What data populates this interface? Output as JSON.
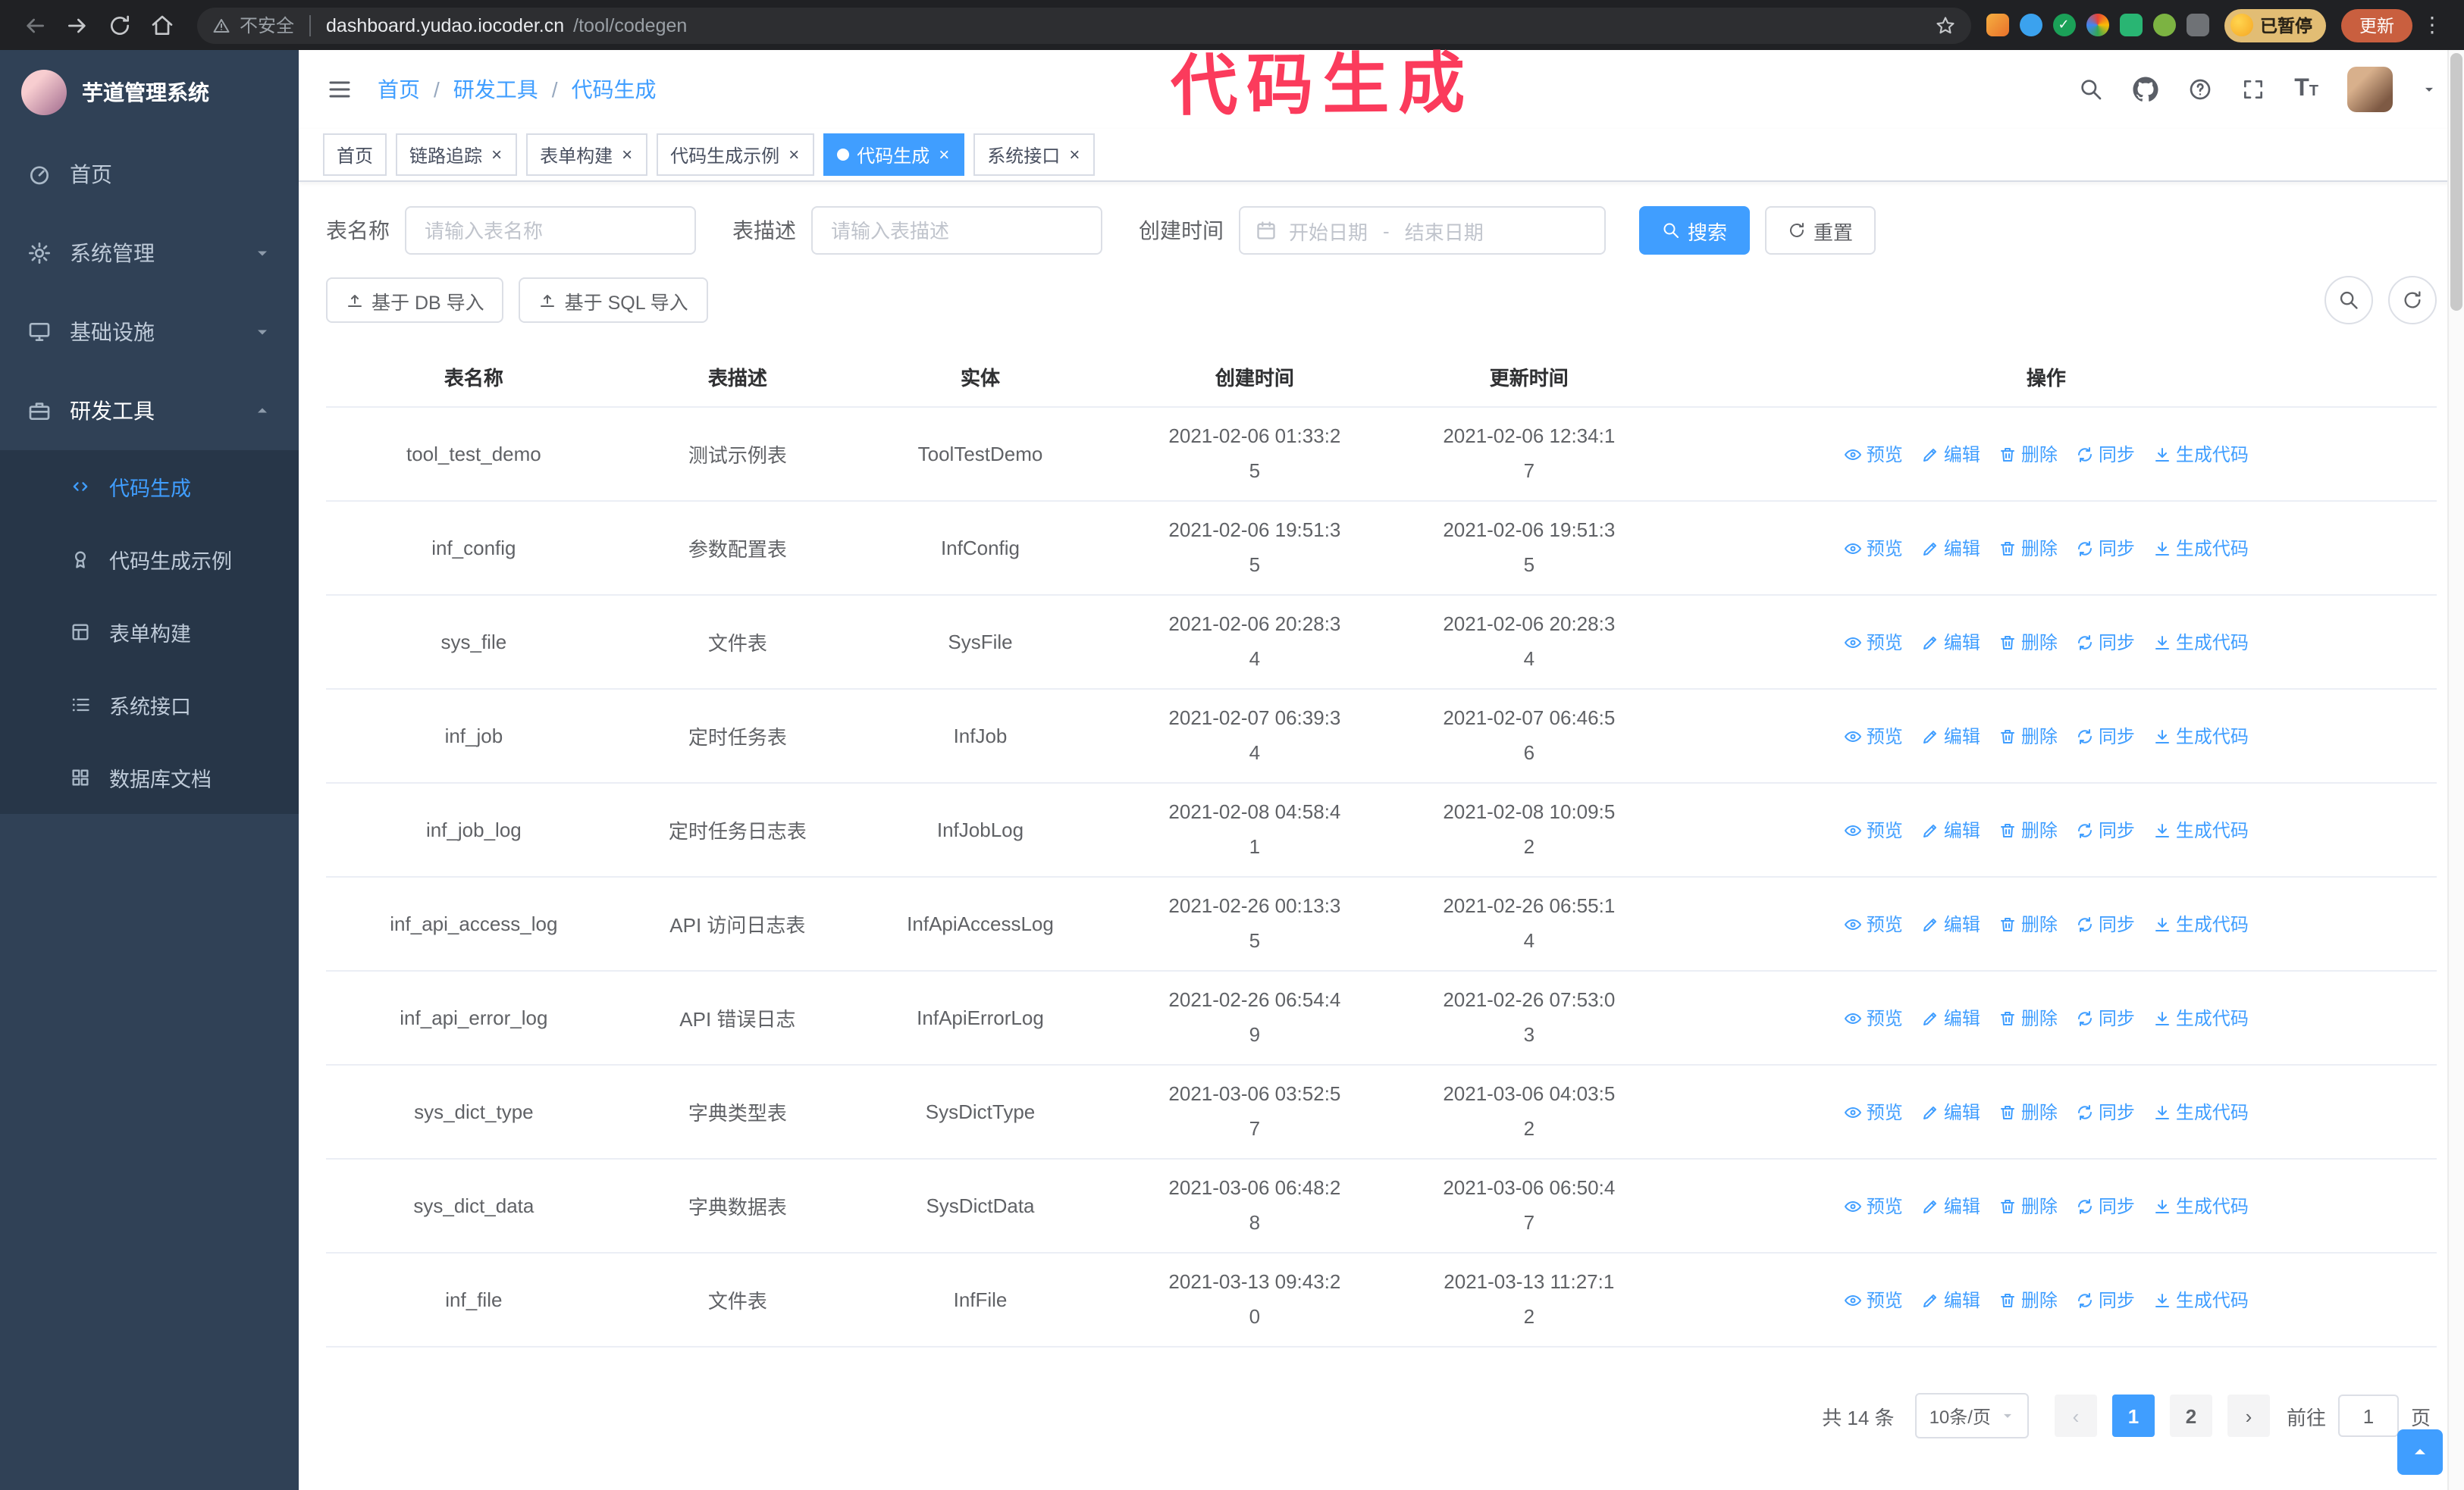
{
  "browser": {
    "security_label": "不安全",
    "url_host": "dashboard.yudao.iocoder.cn",
    "url_path": "/tool/codegen",
    "profile_badge": "已暂停",
    "update_button": "更新"
  },
  "annotation": {
    "text": "代码生成"
  },
  "sidebar": {
    "logo_title": "芋道管理系统",
    "items": [
      {
        "label": "首页",
        "icon": "dashboard"
      },
      {
        "label": "系统管理",
        "icon": "gear"
      },
      {
        "label": "基础设施",
        "icon": "monitor"
      },
      {
        "label": "研发工具",
        "icon": "toolbox"
      }
    ],
    "submenu": [
      {
        "label": "代码生成",
        "icon": "code",
        "active": true
      },
      {
        "label": "代码生成示例",
        "icon": "badge"
      },
      {
        "label": "表单构建",
        "icon": "form"
      },
      {
        "label": "系统接口",
        "icon": "list"
      },
      {
        "label": "数据库文档",
        "icon": "grid"
      }
    ]
  },
  "header": {
    "breadcrumb": [
      {
        "label": "首页"
      },
      {
        "label": "研发工具"
      },
      {
        "label": "代码生成"
      }
    ]
  },
  "tabs": [
    {
      "label": "首页",
      "closable": false,
      "active": false
    },
    {
      "label": "链路追踪",
      "closable": true,
      "active": false
    },
    {
      "label": "表单构建",
      "closable": true,
      "active": false
    },
    {
      "label": "代码生成示例",
      "closable": true,
      "active": false
    },
    {
      "label": "代码生成",
      "closable": true,
      "active": true
    },
    {
      "label": "系统接口",
      "closable": true,
      "active": false
    }
  ],
  "filters": {
    "table_name_label": "表名称",
    "table_name_placeholder": "请输入表名称",
    "table_desc_label": "表描述",
    "table_desc_placeholder": "请输入表描述",
    "create_time_label": "创建时间",
    "start_date_placeholder": "开始日期",
    "range_separator": "-",
    "end_date_placeholder": "结束日期",
    "search_button": "搜索",
    "reset_button": "重置"
  },
  "toolbar": {
    "import_db_button": "基于 DB 导入",
    "import_sql_button": "基于 SQL 导入"
  },
  "table": {
    "columns": [
      "表名称",
      "表描述",
      "实体",
      "创建时间",
      "更新时间",
      "操作"
    ],
    "actions": [
      {
        "key": "preview",
        "label": "预览",
        "icon": "eye"
      },
      {
        "key": "edit",
        "label": "编辑",
        "icon": "edit"
      },
      {
        "key": "delete",
        "label": "删除",
        "icon": "trash"
      },
      {
        "key": "sync",
        "label": "同步",
        "icon": "sync"
      },
      {
        "key": "generate",
        "label": "生成代码",
        "icon": "download"
      }
    ],
    "rows": [
      {
        "name": "tool_test_demo",
        "desc": "测试示例表",
        "entity": "ToolTestDemo",
        "created": "2021-02-06 01:33:25",
        "updated": "2021-02-06 12:34:17"
      },
      {
        "name": "inf_config",
        "desc": "参数配置表",
        "entity": "InfConfig",
        "created": "2021-02-06 19:51:35",
        "updated": "2021-02-06 19:51:35"
      },
      {
        "name": "sys_file",
        "desc": "文件表",
        "entity": "SysFile",
        "created": "2021-02-06 20:28:34",
        "updated": "2021-02-06 20:28:34"
      },
      {
        "name": "inf_job",
        "desc": "定时任务表",
        "entity": "InfJob",
        "created": "2021-02-07 06:39:34",
        "updated": "2021-02-07 06:46:56"
      },
      {
        "name": "inf_job_log",
        "desc": "定时任务日志表",
        "entity": "InfJobLog",
        "created": "2021-02-08 04:58:41",
        "updated": "2021-02-08 10:09:52"
      },
      {
        "name": "inf_api_access_log",
        "desc": "API 访问日志表",
        "entity": "InfApiAccessLog",
        "created": "2021-02-26 00:13:35",
        "updated": "2021-02-26 06:55:14"
      },
      {
        "name": "inf_api_error_log",
        "desc": "API 错误日志",
        "entity": "InfApiErrorLog",
        "created": "2021-02-26 06:54:49",
        "updated": "2021-02-26 07:53:03"
      },
      {
        "name": "sys_dict_type",
        "desc": "字典类型表",
        "entity": "SysDictType",
        "created": "2021-03-06 03:52:57",
        "updated": "2021-03-06 04:03:52"
      },
      {
        "name": "sys_dict_data",
        "desc": "字典数据表",
        "entity": "SysDictData",
        "created": "2021-03-06 06:48:28",
        "updated": "2021-03-06 06:50:47"
      },
      {
        "name": "inf_file",
        "desc": "文件表",
        "entity": "InfFile",
        "created": "2021-03-13 09:43:20",
        "updated": "2021-03-13 11:27:12"
      }
    ]
  },
  "pagination": {
    "total_label": "共 14 条",
    "page_size_label": "10条/页",
    "pages": [
      "1",
      "2"
    ],
    "active_page": "1",
    "goto_prefix": "前往",
    "goto_value": "1",
    "goto_suffix": "页"
  },
  "colors": {
    "accent": "#409eff",
    "annotation": "#fb3b5c",
    "sidebar": "#304156"
  }
}
